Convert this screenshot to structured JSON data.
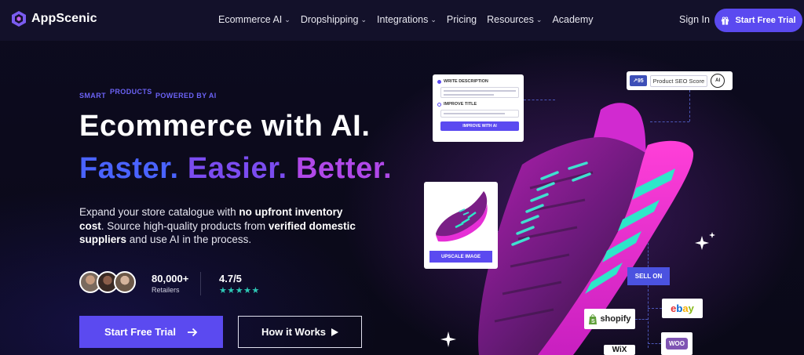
{
  "brand": {
    "name": "AppScenic"
  },
  "nav": {
    "items": [
      {
        "label": "Ecommerce AI",
        "dropdown": true
      },
      {
        "label": "Dropshipping",
        "dropdown": true
      },
      {
        "label": "Integrations",
        "dropdown": true
      },
      {
        "label": "Pricing",
        "dropdown": false
      },
      {
        "label": "Resources",
        "dropdown": true
      },
      {
        "label": "Academy",
        "dropdown": false
      }
    ],
    "sign_in": "Sign In",
    "cta": "Start Free Trial"
  },
  "hero": {
    "eyebrow": [
      "SMART",
      "PRODUCTS",
      "POWERED BY AI"
    ],
    "headline1": "Ecommerce with AI.",
    "headline2_parts": [
      "Faster.",
      "Easier.",
      "Better."
    ],
    "description": {
      "p1": "Expand your store catalogue with ",
      "b1": "no upfront inventory cost",
      "p2": ". Source high-quality products from ",
      "b2": "verified domestic suppliers",
      "p3": " and use AI in the process."
    },
    "retailers_count": "80,000+",
    "retailers_label": "Retailers",
    "rating": "4.7/5",
    "stars": "★★★★★",
    "cta_primary": "Start Free Trial",
    "cta_secondary": "How it Works"
  },
  "visual": {
    "write_description": "WRITE DESCRIPTION",
    "improve_title": "IMPROVE TITLE",
    "improve_with_ai": "IMPROVE WITH AI",
    "upscale_image": "UPSCALE IMAGE",
    "seo_score": "95",
    "seo_label": "Product SEO Score",
    "ai_badge": "AI",
    "sell_on": "SELL ON",
    "marketplaces": [
      "shopify",
      "ebay",
      "WOO",
      "WiX"
    ]
  },
  "colors": {
    "accent": "#5b4af0",
    "faster": "#4a63ff",
    "easier": "#7b4cf0",
    "better": "#b048e8",
    "stars": "#2ec7b5"
  }
}
